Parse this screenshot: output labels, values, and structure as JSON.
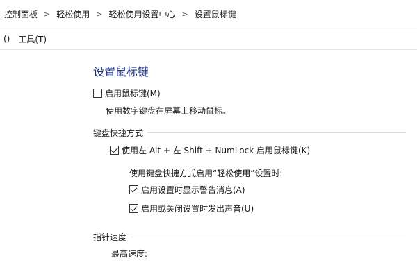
{
  "breadcrumb": {
    "items": [
      "控制面板",
      "轻松使用",
      "轻松使用设置中心",
      "设置鼠标键"
    ],
    "separator": ">"
  },
  "menubar": {
    "partial_item": "()",
    "tools": "工具(T)"
  },
  "page": {
    "title": "设置鼠标键"
  },
  "mouse_keys": {
    "enable_label": "启用鼠标键(M)",
    "enable_checked": false,
    "description": "使用数字键盘在屏幕上移动鼠标。"
  },
  "keyboard_shortcut": {
    "section_label": "键盘快捷方式",
    "shortcut_label": "使用左 Alt + 左 Shift + NumLock 启用鼠标键(K)",
    "shortcut_checked": true,
    "sub_heading": "使用键盘快捷方式启用“轻松使用”设置时:",
    "warning_label": "启用设置时显示警告消息(A)",
    "warning_checked": true,
    "sound_label": "启用或关闭设置时发出声音(U)",
    "sound_checked": true
  },
  "pointer_speed": {
    "section_label": "指针速度",
    "top_speed_label": "最高速度:"
  },
  "colors": {
    "title_blue": "#1e3287",
    "divider": "#e3e3e3"
  }
}
